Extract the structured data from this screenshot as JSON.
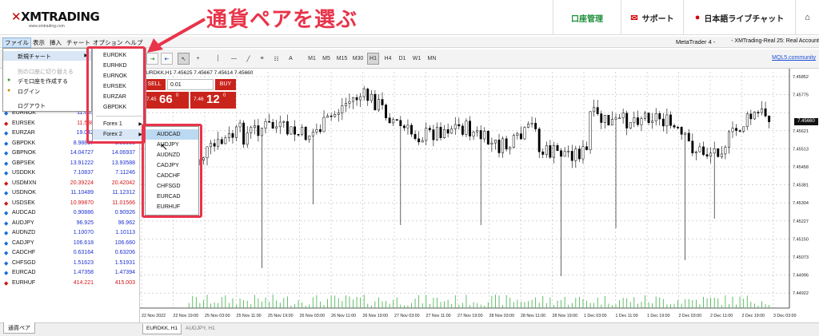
{
  "header": {
    "logo_text": "XMTRADING",
    "logo_sub": "www.xmtrading.com",
    "headline": "通貨ペアを選ぶ",
    "nav": [
      {
        "label": "口座管理",
        "icon": ""
      },
      {
        "label": "サポート",
        "icon": "envelope-icon"
      },
      {
        "label": "日本語ライブチャット",
        "icon": "chat-bubble-icon"
      },
      {
        "label": "",
        "icon": "home-icon"
      }
    ]
  },
  "menubar": {
    "items": [
      "ファイル",
      "表示",
      "挿入",
      "チャート",
      "オプション",
      "ヘルプ"
    ],
    "metatrader": "MetaTrader 4 -",
    "account": "- XMTrading-Real 25: Real Account"
  },
  "toolbar": {
    "timeframes": [
      "M1",
      "M5",
      "M15",
      "M30",
      "H1",
      "H4",
      "D1",
      "W1",
      "MN"
    ],
    "selected_timeframe": "H1",
    "mql_link": "MQL5.community"
  },
  "file_menu": {
    "items": [
      {
        "label": "新規チャート",
        "highlight": true,
        "disabled": false,
        "submenu": true
      },
      {
        "label": "別の口座に切り替える",
        "highlight": false,
        "disabled": true,
        "submenu": false
      },
      {
        "label": "デモ口座を作成する",
        "highlight": false,
        "disabled": false,
        "submenu": false,
        "icon": "person-plus-icon"
      },
      {
        "label": "ログイン",
        "highlight": false,
        "disabled": false,
        "submenu": false,
        "icon": "login-icon"
      },
      {
        "label": "ログアウト",
        "highlight": false,
        "disabled": false,
        "submenu": false
      }
    ]
  },
  "submenu_new_chart": {
    "items": [
      "EURDKK",
      "EURHKD",
      "EURNOK",
      "EURSEK",
      "EURZAR",
      "GBPDKK"
    ],
    "folders": [
      "Forex 1",
      "Forex 2"
    ],
    "highlighted_folder": "Forex 2"
  },
  "submenu_forex2": {
    "items": [
      "AUDCAD",
      "AUDJPY",
      "AUDNZD",
      "CADJPY",
      "CADCHF",
      "CHFSGD",
      "EURCAD",
      "EURHUF"
    ],
    "highlighted": "AUDCAD"
  },
  "market_watch": {
    "rows": [
      {
        "symbol": "EURNOK",
        "bid": "11.651",
        "ask": "",
        "dir": "up",
        "bid_color": "blue"
      },
      {
        "symbol": "EURSEK",
        "bid": "11.538",
        "ask": "",
        "dir": "down",
        "bid_color": "red"
      },
      {
        "symbol": "EURZAR",
        "bid": "19.042",
        "ask": "",
        "dir": "up",
        "bid_color": "blue"
      },
      {
        "symbol": "GBPDKK",
        "bid": "8.98837",
        "ask": "9.00000",
        "dir": "up",
        "bid_color": "blue"
      },
      {
        "symbol": "GBPNOK",
        "bid": "14.04727",
        "ask": "14.06937",
        "dir": "up",
        "bid_color": "blue"
      },
      {
        "symbol": "GBPSEK",
        "bid": "13.91222",
        "ask": "13.93588",
        "dir": "up",
        "bid_color": "blue"
      },
      {
        "symbol": "USDDKK",
        "bid": "7.10837",
        "ask": "7.11246",
        "dir": "up",
        "bid_color": "blue"
      },
      {
        "symbol": "USDMXN",
        "bid": "20.39224",
        "ask": "20.42042",
        "dir": "down",
        "bid_color": "red"
      },
      {
        "symbol": "USDNOK",
        "bid": "11.10489",
        "ask": "11.12312",
        "dir": "up",
        "bid_color": "blue"
      },
      {
        "symbol": "USDSEK",
        "bid": "10.99870",
        "ask": "11.01566",
        "dir": "down",
        "bid_color": "red"
      },
      {
        "symbol": "AUDCAD",
        "bid": "0.90886",
        "ask": "0.90926",
        "dir": "up",
        "bid_color": "blue"
      },
      {
        "symbol": "AUDJPY",
        "bid": "96.925",
        "ask": "96.962",
        "dir": "up",
        "bid_color": "blue"
      },
      {
        "symbol": "AUDNZD",
        "bid": "1.10070",
        "ask": "1.10113",
        "dir": "up",
        "bid_color": "blue"
      },
      {
        "symbol": "CADJPY",
        "bid": "106.618",
        "ask": "106.660",
        "dir": "up",
        "bid_color": "blue"
      },
      {
        "symbol": "CADCHF",
        "bid": "0.63164",
        "ask": "0.63206",
        "dir": "up",
        "bid_color": "blue"
      },
      {
        "symbol": "CHFSGD",
        "bid": "1.51623",
        "ask": "1.51931",
        "dir": "up",
        "bid_color": "blue"
      },
      {
        "symbol": "EURCAD",
        "bid": "1.47358",
        "ask": "1.47394",
        "dir": "up",
        "bid_color": "blue"
      },
      {
        "symbol": "EURHUF",
        "bid": "414.221",
        "ask": "415.003",
        "dir": "down",
        "bid_color": "red"
      }
    ],
    "tab_label": "通貨ペア"
  },
  "chart": {
    "title": "EURDKK,H1  7.45625 7.45667 7.45614 7.45660",
    "sell_label": "SELL",
    "buy_label": "BUY",
    "lot": "0.01",
    "sell_small": "7.45",
    "sell_big": "66",
    "sell_sup": "0",
    "buy_small": "7.46",
    "buy_big": "12",
    "buy_sup": "0",
    "current_price": "7.45660",
    "y_labels": [
      "7.45852",
      "7.45775",
      "7.45660",
      "7.45621",
      "7.45513",
      "7.45458",
      "7.45381",
      "7.45304",
      "7.45227",
      "7.45150",
      "7.45073",
      "7.44996",
      "7.44922"
    ],
    "x_labels": [
      "22 Nov 2022",
      "22 Nov 19:00",
      "25 Nov 03:00",
      "25 Nov 11:00",
      "25 Nov 19:00",
      "26 Nov 03:00",
      "26 Nov 11:00",
      "26 Nov 19:00",
      "27 Nov 03:00",
      "27 Nov 11:00",
      "27 Nov 19:00",
      "28 Nov 03:00",
      "28 Nov 11:00",
      "28 Nov 19:00",
      "1 Dec 03:00",
      "1 Dec 11:00",
      "1 Dec 19:00",
      "2 Dec 03:00",
      "2 Dec 11:00",
      "2 Dec 19:00",
      "3 Dec 03:00"
    ],
    "tabs": [
      "EURDKK, H1",
      "AUDJPY, H1"
    ],
    "up_color": "#000000",
    "down_color": "#ffffff",
    "volume_color": "#3cb043"
  }
}
